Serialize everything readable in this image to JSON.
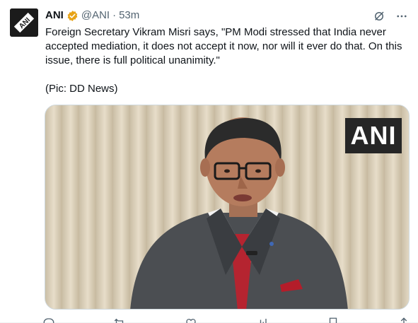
{
  "author": {
    "display_name": "ANI",
    "handle": "@ANI",
    "separator": "·",
    "time_ago": "53m",
    "avatar_icon": "ani-logo-icon",
    "verified_icon": "verified-badge-icon",
    "verified_color": "#e8a317"
  },
  "header_actions": {
    "grok_icon": "grok-icon",
    "more_icon": "more-options-icon"
  },
  "tweet": {
    "text": "Foreign Secretary Vikram Misri says, \"PM Modi stressed that India never accepted mediation, it does not accept it now, nor will it ever do that. On this issue, there is full political unanimity.\"\n\n(Pic: DD News)"
  },
  "media": {
    "watermark": "ANI",
    "description_icon": "video-still-man-speaking"
  },
  "actions": {
    "icons": [
      "reply-icon",
      "repost-icon",
      "like-icon",
      "views-icon",
      "bookmark-icon",
      "share-icon"
    ]
  },
  "colors": {
    "text": "#0f1419",
    "secondary": "#536471",
    "border": "#cfd9de"
  }
}
